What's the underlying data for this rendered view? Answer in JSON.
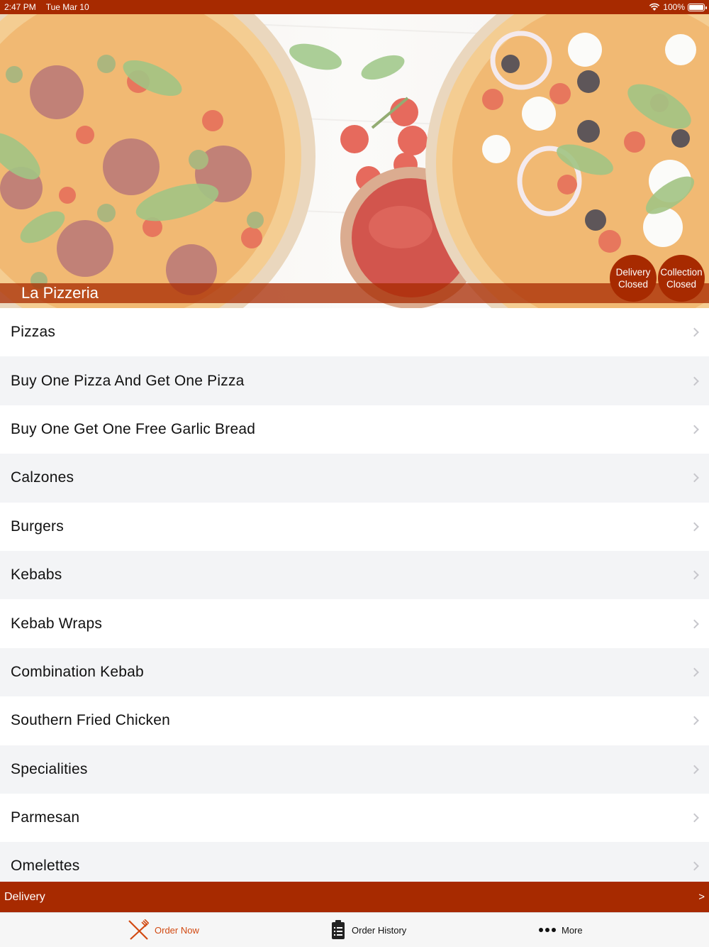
{
  "status_bar": {
    "time": "2:47 PM",
    "date": "Tue Mar 10",
    "battery": "100%",
    "icons": [
      "wifi-icon",
      "battery-icon"
    ]
  },
  "header": {
    "restaurant_name": "La Pizzeria",
    "delivery_status": {
      "line1": "Delivery",
      "line2": "Closed"
    },
    "collection_status": {
      "line1": "Collection",
      "line2": "Closed"
    }
  },
  "menu": {
    "categories": [
      "Pizzas",
      "Buy One Pizza And Get One Pizza",
      "Buy One Get One Free Garlic Bread",
      "Calzones",
      "Burgers",
      "Kebabs",
      "Kebab Wraps",
      "Combination Kebab",
      "Southern Fried Chicken",
      "Specialities",
      "Parmesan",
      "Omelettes"
    ]
  },
  "delivery_bar": {
    "label": "Delivery",
    "arrow": ">"
  },
  "tabs": [
    {
      "label": "Order Now",
      "icon": "fork-knife-icon",
      "active": true
    },
    {
      "label": "Order History",
      "icon": "clipboard-list-icon",
      "active": false
    },
    {
      "label": "More",
      "icon": "more-dots-icon",
      "active": false
    }
  ],
  "colors": {
    "brand": "#a72a00",
    "active_tab": "#d24a12"
  }
}
